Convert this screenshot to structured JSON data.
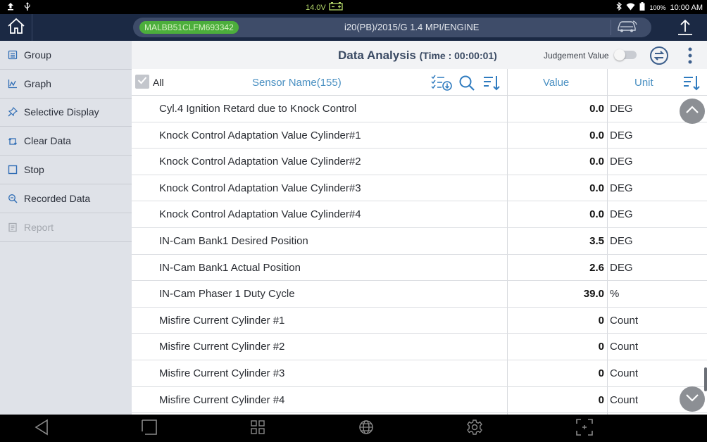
{
  "status": {
    "voltage": "14.0V",
    "battery_pct": "100%",
    "time": "10:00 AM"
  },
  "appbar": {
    "vin": "MALBB51CLFM693342",
    "vehicle": "i20(PB)/2015/G 1.4 MPI/ENGINE"
  },
  "sidebar": {
    "items": [
      {
        "label": "Group",
        "icon": "group-icon"
      },
      {
        "label": "Graph",
        "icon": "graph-icon"
      },
      {
        "label": "Selective Display",
        "icon": "pin-icon"
      },
      {
        "label": "Clear Data",
        "icon": "clear-icon"
      },
      {
        "label": "Stop",
        "icon": "stop-icon"
      },
      {
        "label": "Recorded Data",
        "icon": "recorded-icon"
      },
      {
        "label": "Report",
        "icon": "report-icon"
      }
    ]
  },
  "title": {
    "main": "Data Analysis",
    "time": "(Time : 00:00:01)",
    "judgement": "Judgement Value"
  },
  "table": {
    "all_label": "All",
    "sensor_header": "Sensor Name(155)",
    "value_header": "Value",
    "unit_header": "Unit",
    "rows": [
      {
        "name": "Cyl.4 Ignition Retard due to Knock Control",
        "value": "0.0",
        "unit": "DEG"
      },
      {
        "name": "Knock Control Adaptation Value Cylinder#1",
        "value": "0.0",
        "unit": "DEG"
      },
      {
        "name": "Knock Control Adaptation Value Cylinder#2",
        "value": "0.0",
        "unit": "DEG"
      },
      {
        "name": "Knock Control Adaptation Value Cylinder#3",
        "value": "0.0",
        "unit": "DEG"
      },
      {
        "name": "Knock Control Adaptation Value Cylinder#4",
        "value": "0.0",
        "unit": "DEG"
      },
      {
        "name": "IN-Cam Bank1 Desired Position",
        "value": "3.5",
        "unit": "DEG"
      },
      {
        "name": "IN-Cam Bank1 Actual Position",
        "value": "2.6",
        "unit": "DEG"
      },
      {
        "name": "IN-Cam Phaser 1 Duty Cycle",
        "value": "39.0",
        "unit": "%"
      },
      {
        "name": "Misfire Current Cylinder #1",
        "value": "0",
        "unit": "Count"
      },
      {
        "name": "Misfire Current Cylinder #2",
        "value": "0",
        "unit": "Count"
      },
      {
        "name": "Misfire Current Cylinder #3",
        "value": "0",
        "unit": "Count"
      },
      {
        "name": "Misfire Current Cylinder #4",
        "value": "0",
        "unit": "Count"
      }
    ]
  },
  "colors": {
    "header_bg": "#1b2944",
    "vin_badge": "#4cae3c",
    "column_header": "#4a90c2",
    "voltage": "#b5d96a"
  }
}
